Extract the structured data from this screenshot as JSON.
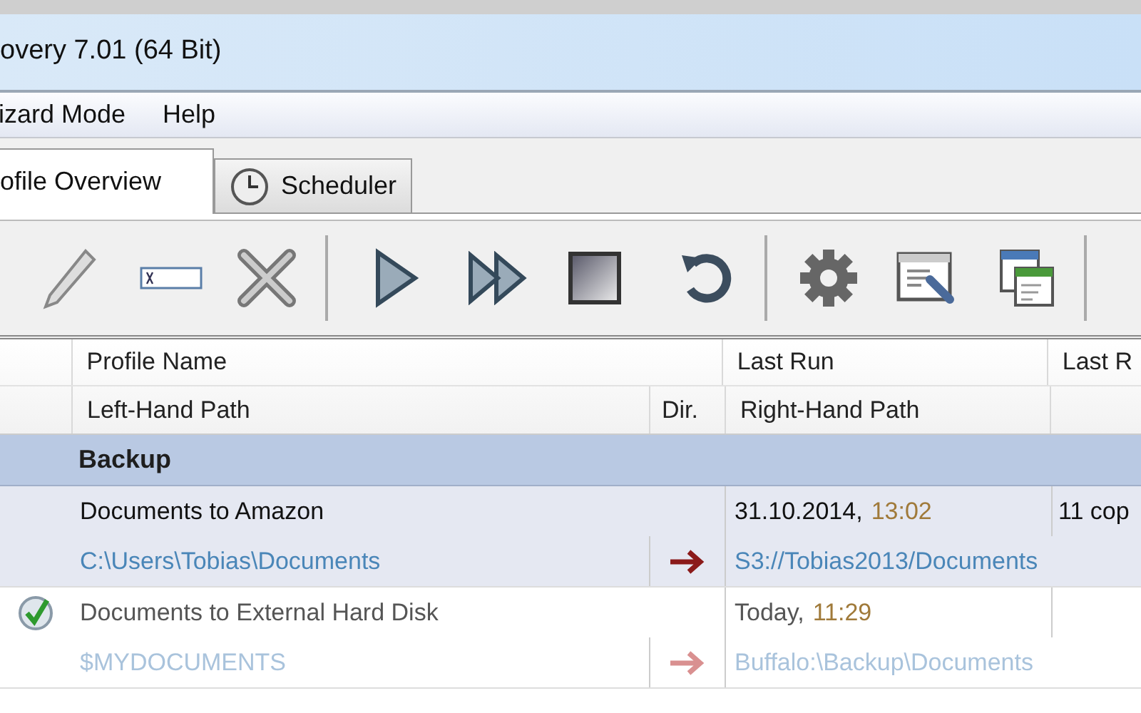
{
  "window": {
    "title": "overy 7.01 (64 Bit)"
  },
  "menu": [
    {
      "label": "izard Mode"
    },
    {
      "label": "Help"
    }
  ],
  "tabs": [
    {
      "label": "ofile Overview",
      "selected": true,
      "has_icon": false
    },
    {
      "label": "Scheduler",
      "selected": false,
      "has_icon": true
    }
  ],
  "table": {
    "header_top": [
      "Profile Name",
      "Last Run",
      "Last R"
    ],
    "header_bottom": [
      "Left-Hand Path",
      "Dir.",
      "Right-Hand Path"
    ],
    "groups": [
      {
        "name": "Backup",
        "profiles": [
          {
            "name": "Documents to Amazon",
            "last_run_date": "31.10.2014,",
            "last_run_time": "13:02",
            "column_4": "11 cop",
            "left_path": "C:\\Users\\Tobias\\Documents",
            "right_path": "S3://Tobias2013/Documents",
            "status_ok": false,
            "selected": true,
            "faded": false
          },
          {
            "name": "Documents to External Hard Disk",
            "last_run_date": "Today,",
            "last_run_time": "11:29",
            "left_path": "$MYDOCUMENTS",
            "right_path": "Buffalo:\\Backup\\Documents",
            "status_ok": true,
            "selected": false,
            "faded": true
          }
        ]
      }
    ]
  }
}
